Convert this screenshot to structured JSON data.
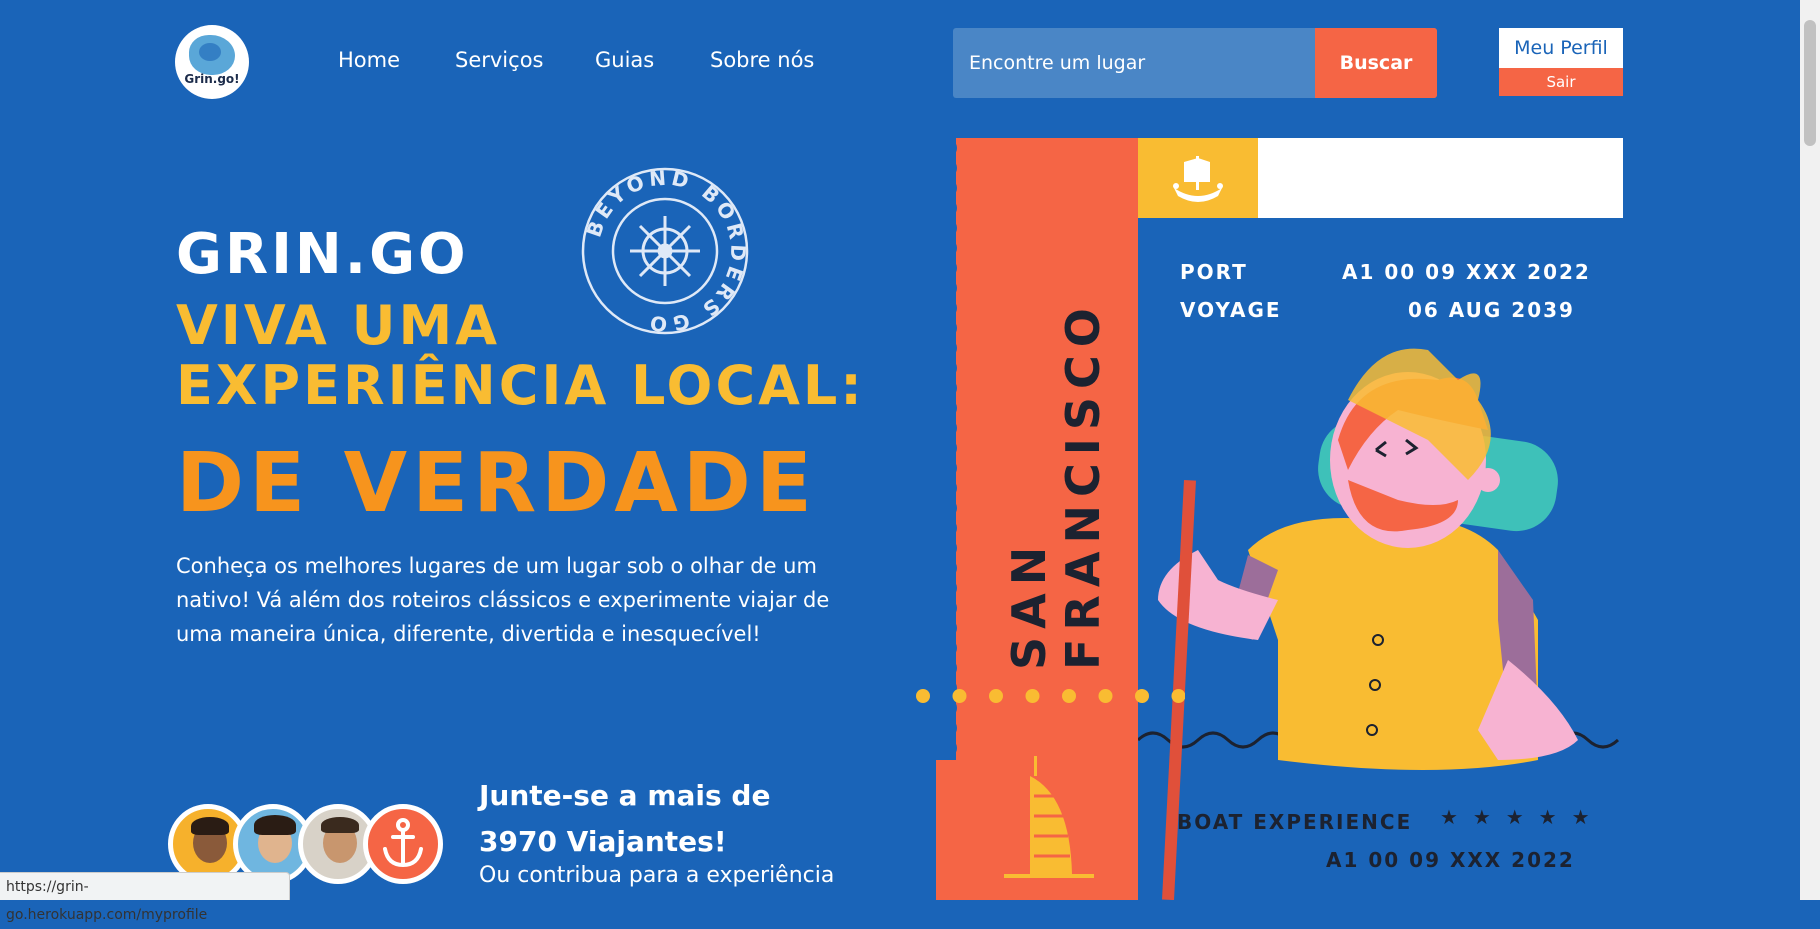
{
  "header": {
    "logo_text": "Grin.go!",
    "nav": [
      "Home",
      "Serviços",
      "Guias",
      "Sobre nós"
    ],
    "search_placeholder": "Encontre um lugar",
    "search_button": "Buscar",
    "profile_button": "Meu Perfil",
    "logout_button": "Sair"
  },
  "hero": {
    "brand": "GRIN.GO",
    "tagline_line1": "VIVA UMA",
    "tagline_line2": "EXPERIÊNCIA LOCAL:",
    "tagline_line3": "DE VERDADE",
    "description": "Conheça os melhores lugares de um lugar sob o olhar de um nativo! Vá além dos roteiros clássicos e experimente viajar de uma maneira única, diferente, divertida e inesquecível!",
    "stamp_text": "BEYOND BORDERS GO"
  },
  "join": {
    "title_line1": "Junte-se a mais de",
    "title_line2": "3970 Viajantes!",
    "subtitle": "Ou contribua para a experiência"
  },
  "ticket": {
    "city": "SAN FRANCISCO",
    "port_label": "PORT",
    "port_value": "A1 00 09 XXX 2022",
    "voyage_label": "VOYAGE",
    "voyage_value": "06 AUG 2039",
    "experience_label": "BOAT EXPERIENCE",
    "stars": "★ ★ ★ ★ ★",
    "code": "A1 00 09 XXX 2022"
  },
  "status_bar": {
    "url": "https://grin-go.herokuapp.com/myprofile"
  },
  "colors": {
    "background": "#1a64b8",
    "accent_orange": "#f56545",
    "accent_yellow": "#f9bc32",
    "accent_amber": "#f7941d"
  }
}
